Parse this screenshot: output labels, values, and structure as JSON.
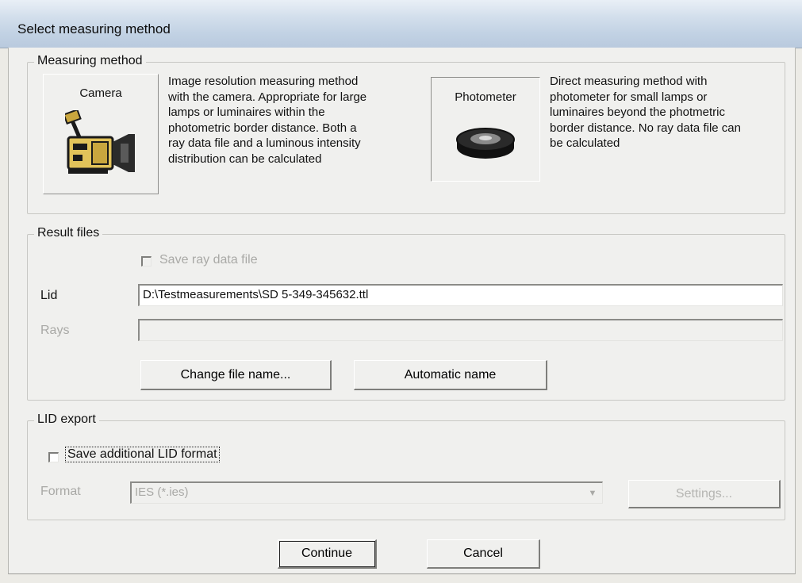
{
  "window": {
    "title": "Select measuring method"
  },
  "measuring_method": {
    "group_title": "Measuring method",
    "camera": {
      "label": "Camera",
      "icon": "camera-icon",
      "description_lines": [
        "Image resolution measuring method",
        "with the camera. Appropriate for large",
        "lamps or luminaires within the",
        "photometric border distance. Both a",
        "ray data file and a luminous intensity",
        "distribution can be calculated"
      ]
    },
    "photometer": {
      "label": "Photometer",
      "icon": "photometer-icon",
      "selected": true,
      "description_lines": [
        "Direct measuring method with",
        "photometer for small lamps or",
        "luminaires beyond the photmetric",
        "border distance. No ray data file can",
        "be calculated"
      ]
    }
  },
  "result_files": {
    "group_title": "Result files",
    "save_ray_label": "Save ray data file",
    "save_ray_checked": false,
    "lid_label": "Lid",
    "lid_value": "D:\\Testmeasurements\\SD 5-349-345632.ttl",
    "rays_label": "Rays",
    "rays_value": "",
    "change_btn": "Change file name...",
    "auto_btn": "Automatic name"
  },
  "lid_export": {
    "group_title": "LID export",
    "save_lid_label": "Save additional LID format",
    "save_lid_checked": false,
    "format_label": "Format",
    "format_value": "IES (*.ies)",
    "settings_btn": "Settings..."
  },
  "footer": {
    "continue_btn": "Continue",
    "cancel_btn": "Cancel"
  }
}
